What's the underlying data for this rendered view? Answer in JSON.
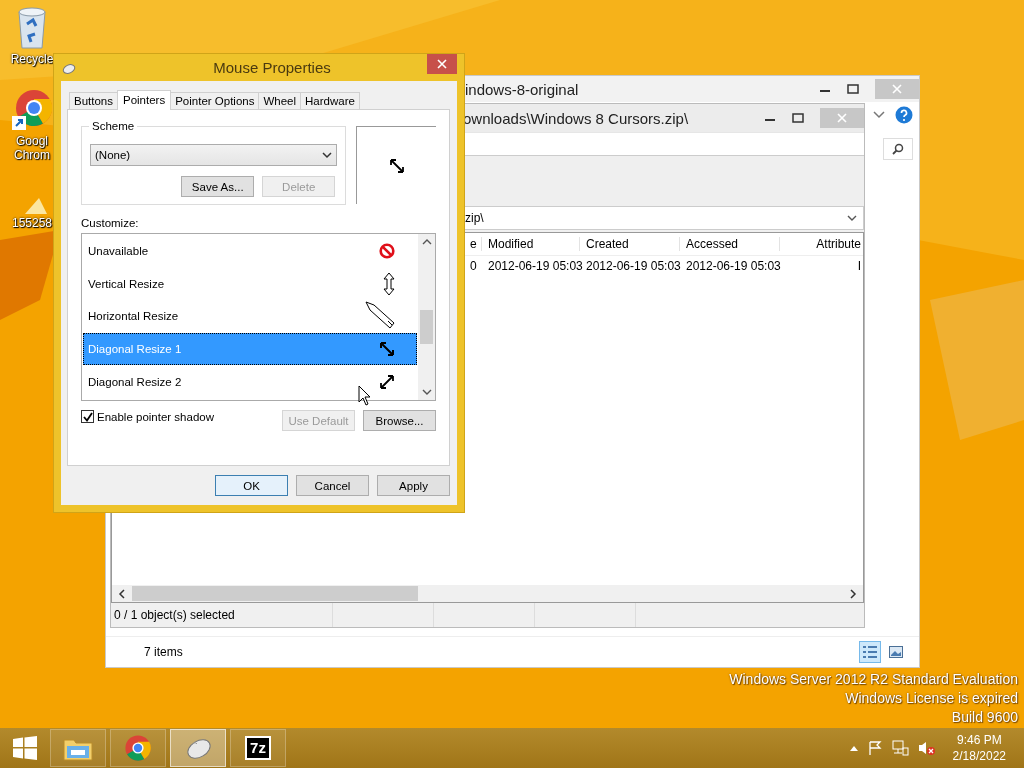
{
  "desktop_icons": [
    {
      "kind": "recycle",
      "lines": [
        "Recycle"
      ]
    },
    {
      "kind": "chrome",
      "lines": [
        "Googl",
        "Chrom"
      ]
    },
    {
      "kind": "file",
      "lines": [
        "155258"
      ]
    }
  ],
  "desktop_notice": [
    "Windows Server 2012 R2 Standard Evaluation",
    "Windows License is expired",
    "Build 9600"
  ],
  "explorer": {
    "title": "indows-8-original",
    "status": "7 items",
    "view_buttons": [
      {
        "kind": "details",
        "selected": true
      },
      {
        "kind": "preview",
        "selected": false
      }
    ]
  },
  "zip_window": {
    "title": "ownloads\\Windows 8 Cursors.zip\\",
    "address": "zip\\",
    "columns": [
      "e",
      "Modified",
      "Created",
      "Accessed",
      "Attribute"
    ],
    "rows": [
      [
        "0",
        "2012-06-19 05:03",
        "2012-06-19 05:03",
        "2012-06-19 05:03",
        "I"
      ]
    ],
    "status": "0 / 1 object(s) selected"
  },
  "dialog": {
    "title": "Mouse Properties",
    "tabs": [
      {
        "label": "Buttons",
        "selected": false
      },
      {
        "label": "Pointers",
        "selected": true
      },
      {
        "label": "Pointer Options",
        "selected": false
      },
      {
        "label": "Wheel",
        "selected": false
      },
      {
        "label": "Hardware",
        "selected": false
      }
    ],
    "scheme": {
      "label": "Scheme",
      "value": "(None)",
      "buttons": [
        {
          "label": "Save As...",
          "disabled": false
        },
        {
          "label": "Delete",
          "disabled": true
        }
      ]
    },
    "customize_label": "Customize:",
    "pointers": [
      {
        "name": "Unavailable",
        "kind": "unavailable",
        "selected": false
      },
      {
        "name": "Vertical Resize",
        "kind": "vertical",
        "selected": false
      },
      {
        "name": "Horizontal Resize",
        "kind": "pen",
        "selected": false
      },
      {
        "name": "Diagonal Resize 1",
        "kind": "diag1",
        "selected": true
      },
      {
        "name": "Diagonal Resize 2",
        "kind": "diag2",
        "selected": false
      }
    ],
    "shadow": {
      "label": "Enable pointer shadow",
      "checked": true
    },
    "list_buttons": [
      {
        "label": "Use Default",
        "disabled": true
      },
      {
        "label": "Browse...",
        "disabled": false
      }
    ],
    "footer_buttons": [
      {
        "label": "OK",
        "default": true
      },
      {
        "label": "Cancel",
        "default": false
      },
      {
        "label": "Apply",
        "default": false
      }
    ]
  },
  "taskbar": {
    "apps": [
      {
        "kind": "explorer",
        "active": false
      },
      {
        "kind": "chrome",
        "active": false
      },
      {
        "kind": "mouse",
        "active": true
      },
      {
        "kind": "sevenzip",
        "active": false,
        "label": "7z"
      }
    ],
    "time": "9:46 PM",
    "date": "2/18/2022"
  }
}
